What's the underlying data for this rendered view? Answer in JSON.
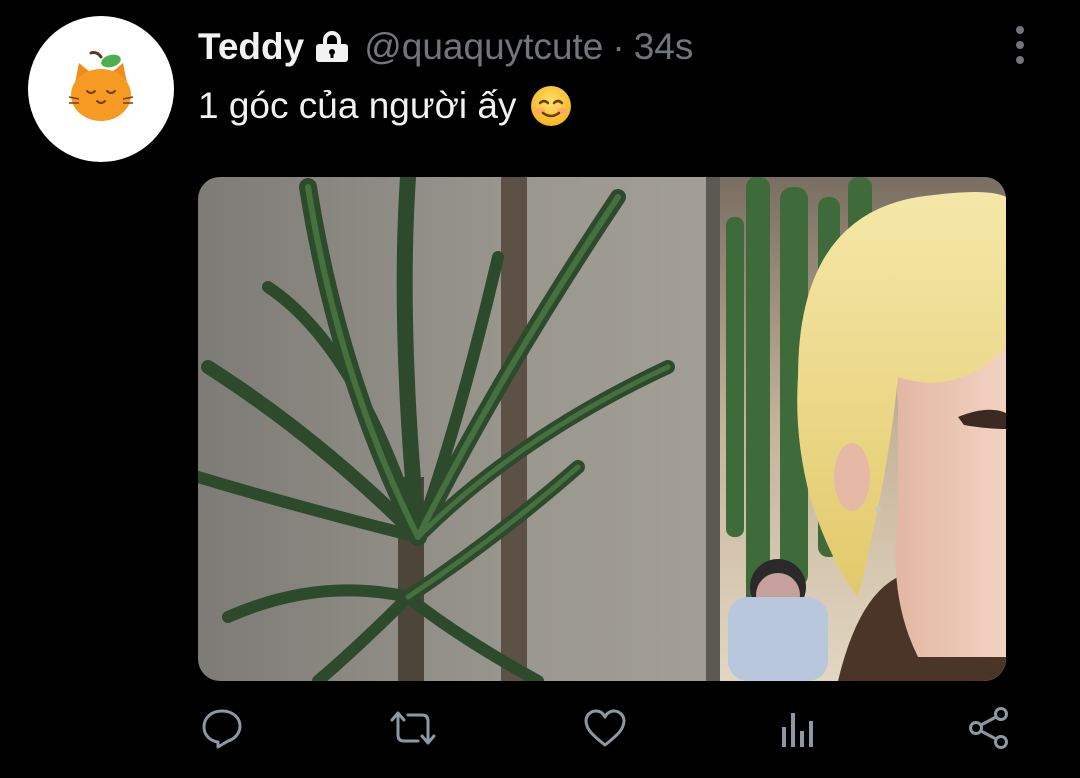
{
  "tweet": {
    "display_name": "Teddy",
    "handle": "@quaquytcute",
    "separator": "·",
    "time": "34s",
    "text": "1 góc của người ấy",
    "emoji": "smiling-face-icon"
  },
  "media": {
    "description_icon": "photo-plant-person"
  },
  "colors": {
    "background": "#000000",
    "text": "#e7e9ea",
    "muted": "#71767b"
  },
  "actions": [
    "reply-icon",
    "retweet-icon",
    "like-icon",
    "analytics-icon",
    "share-icon"
  ]
}
